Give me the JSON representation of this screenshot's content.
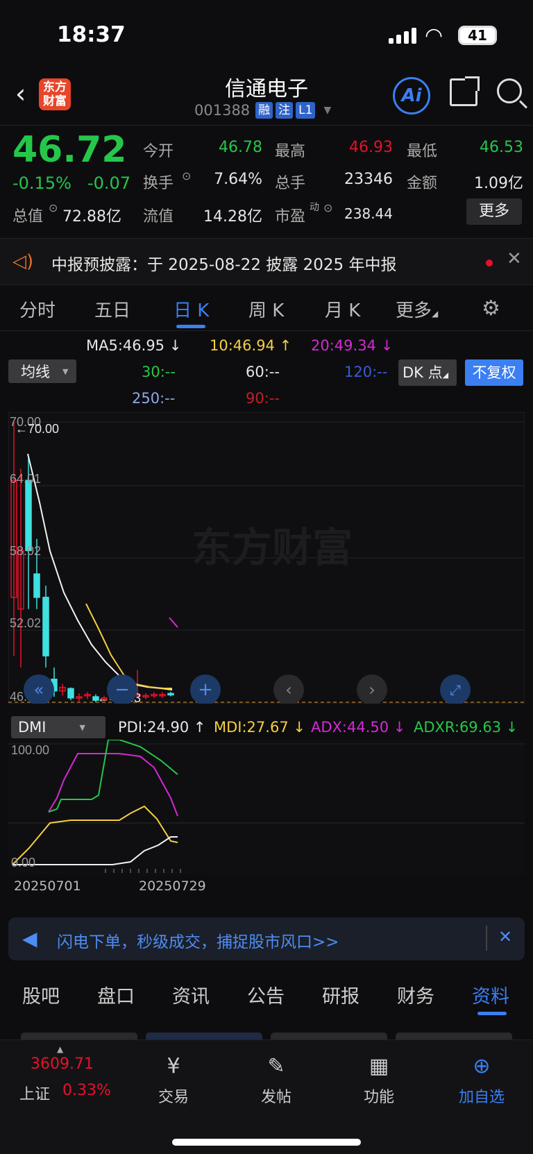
{
  "status": {
    "time": "18:37",
    "battery": "41"
  },
  "header": {
    "logo": "东方\n财富",
    "title": "信通电子",
    "code": "001388",
    "tags": [
      "融",
      "注",
      "L1"
    ]
  },
  "quote": {
    "price": "46.72",
    "pct": "-0.15%",
    "chg": "-0.07",
    "rows": [
      [
        {
          "l": "今开",
          "v": "46.78",
          "c": "#25c74a"
        },
        {
          "l": "最高",
          "v": "46.93",
          "c": "#e8102a"
        },
        {
          "l": "最低",
          "v": "46.53",
          "c": "#25c74a"
        }
      ],
      [
        {
          "l": "换手",
          "v": "7.64%",
          "c": "#e6e6e6"
        },
        {
          "l": "总手",
          "v": "23346",
          "c": "#e6e6e6"
        },
        {
          "l": "金额",
          "v": "1.09亿",
          "c": "#e6e6e6"
        }
      ],
      [
        {
          "l": "总值",
          "v": "72.88亿",
          "c": "#e6e6e6"
        },
        {
          "l": "流值",
          "v": "14.28亿",
          "c": "#e6e6e6"
        },
        {
          "l": "市盈",
          "sup": "动",
          "v": "238.44",
          "c": "#e6e6e6"
        }
      ]
    ],
    "more": "更多"
  },
  "notice": {
    "text": "中报预披露：于 2025-08-22 披露 2025 年中报"
  },
  "ktabs": [
    "分时",
    "五日",
    "日 K",
    "周 K",
    "月 K",
    "更多"
  ],
  "ma": {
    "ma5": "MA5:46.95 ↓",
    "ma10": "10:46.94 ↑",
    "ma20": "20:49.34 ↓",
    "ma30": "30:--",
    "ma60": "60:--",
    "ma120": "120:--",
    "ma250": "250:--",
    "ma90": "90:--",
    "select": "均线",
    "dk": "DK 点",
    "fq": "不复权",
    "colors": {
      "ma5": "#e6e6e6",
      "ma10": "#f4d03f",
      "ma20": "#d42ad4",
      "ma30": "#25c74a",
      "ma60": "#e6e6e6",
      "ma120": "#3b5bd6",
      "ma250": "#8fa8e8",
      "ma90": "#c0202a"
    }
  },
  "chart": {
    "ticks": [
      "70.00",
      "64.01",
      "58.02",
      "52.02",
      "46.03"
    ],
    "high_label": "←70.00",
    "low_label": "←46.03",
    "watermark": "东方财富"
  },
  "dmi": {
    "select": "DMI",
    "pdi": "PDI:24.90 ↑",
    "mdi": "MDI:27.67 ↓",
    "adx": "ADX:44.50 ↓",
    "adxr": "ADXR:69.63 ↓",
    "top": "100.00",
    "bottom": "0.00",
    "x_start": "20250701",
    "x_end": "20250729"
  },
  "banner": {
    "text": "闪电下单，秒级成交，捕捉股市风口>>"
  },
  "btabs": [
    "股吧",
    "盘口",
    "资讯",
    "公告",
    "研报",
    "财务",
    "资料"
  ],
  "footer": {
    "index_value": "3609.71",
    "index_name": "上证",
    "index_pct": "0.33%",
    "items": [
      "交易",
      "发帖",
      "功能",
      "加自选"
    ]
  }
}
